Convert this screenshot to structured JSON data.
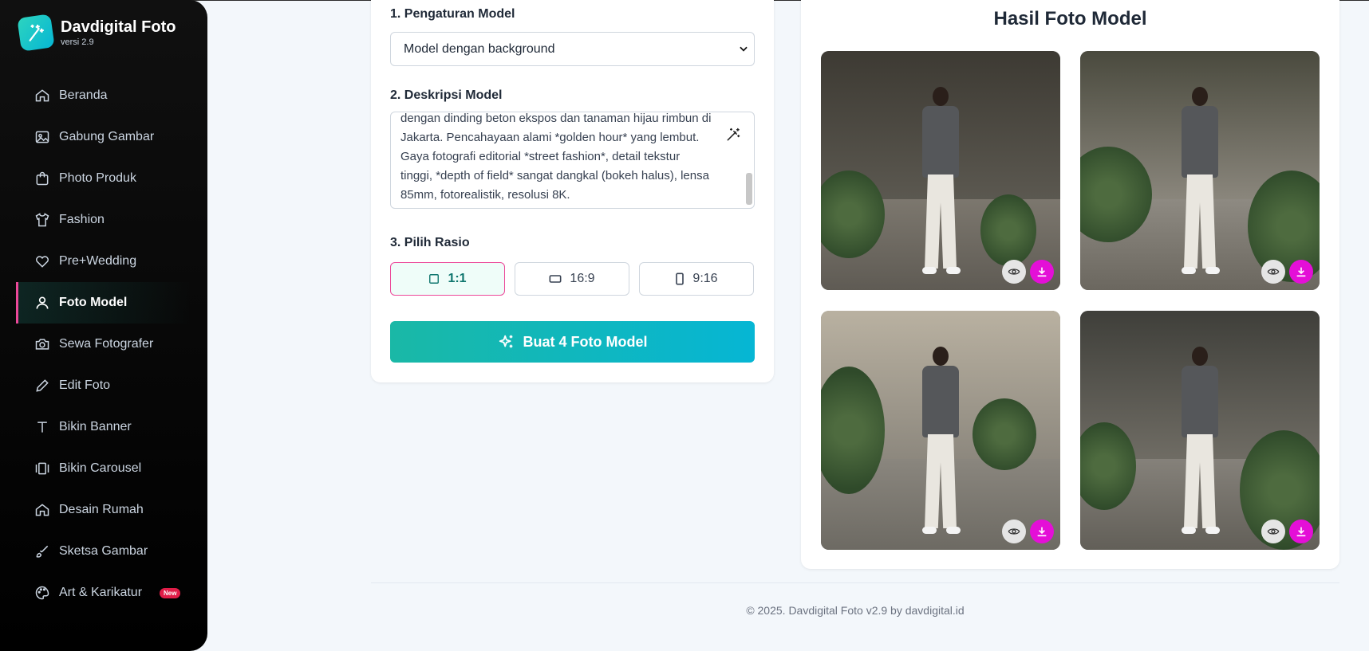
{
  "brand": {
    "title": "Davdigital Foto",
    "version": "versi 2.9"
  },
  "sidebar": {
    "items": [
      {
        "label": "Beranda",
        "icon": "home-icon"
      },
      {
        "label": "Gabung Gambar",
        "icon": "image-icon"
      },
      {
        "label": "Photo Produk",
        "icon": "shopping-bag-icon"
      },
      {
        "label": "Fashion",
        "icon": "shirt-icon"
      },
      {
        "label": "Pre+Wedding",
        "icon": "heart-icon"
      },
      {
        "label": "Foto Model",
        "icon": "user-icon",
        "active": true
      },
      {
        "label": "Sewa Fotografer",
        "icon": "camera-icon"
      },
      {
        "label": "Edit Foto",
        "icon": "pencil-icon"
      },
      {
        "label": "Bikin Banner",
        "icon": "text-icon"
      },
      {
        "label": "Bikin Carousel",
        "icon": "carousel-icon"
      },
      {
        "label": "Desain Rumah",
        "icon": "home-icon"
      },
      {
        "label": "Sketsa Gambar",
        "icon": "brush-icon"
      },
      {
        "label": "Art & Karikatur",
        "icon": "palette-icon",
        "badge": "New"
      }
    ]
  },
  "form": {
    "section1_label": "1. Pengaturan Model",
    "model_select_value": "Model dengan background",
    "section2_label": "2. Deskripsi Model",
    "description_text": "dengan dinding beton ekspos dan tanaman hijau rimbun di Jakarta. Pencahayaan alami *golden hour* yang lembut. Gaya fotografi editorial *street fashion*, detail tekstur tinggi, *depth of field* sangat dangkal (bokeh halus), lensa 85mm, fotorealistik, resolusi 8K.",
    "section3_label": "3. Pilih Rasio",
    "ratios": [
      {
        "label": "1:1",
        "selected": true
      },
      {
        "label": "16:9",
        "selected": false
      },
      {
        "label": "9:16",
        "selected": false
      }
    ],
    "generate_label": "Buat 4 Foto Model"
  },
  "results": {
    "title": "Hasil Foto Model",
    "photos": [
      {
        "alt": "Foto model 1"
      },
      {
        "alt": "Foto model 2"
      },
      {
        "alt": "Foto model 3"
      },
      {
        "alt": "Foto model 4"
      }
    ]
  },
  "footer": {
    "text": "© 2025. Davdigital Foto v2.9 by davdigital.id"
  },
  "colors": {
    "accent": "#1ab8a6",
    "highlight": "#ec4899",
    "download": "#e40fd7"
  }
}
